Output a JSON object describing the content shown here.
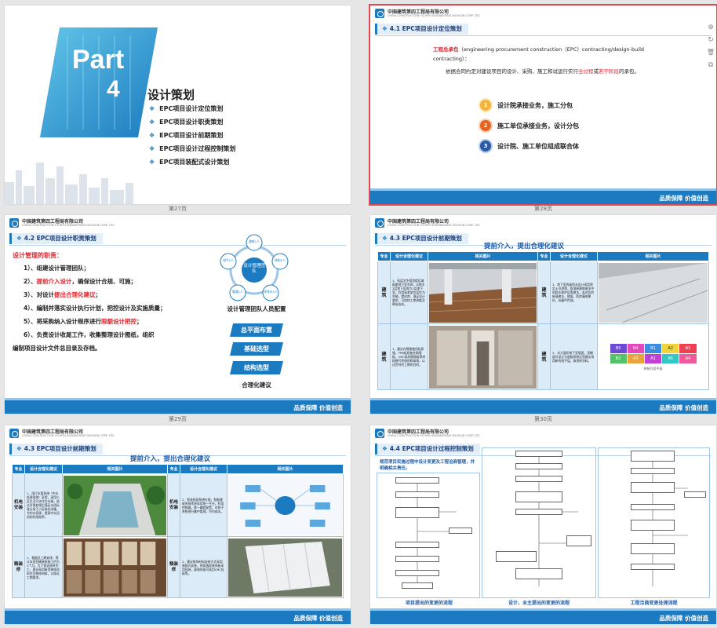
{
  "company": {
    "name": "中国建筑第四工程局有限公司",
    "name_en": "CHINA CONSTRUCTION FOURTH ENGINEERING DIVISION CORP. LTD."
  },
  "footer_text": "品质保障  价值创造",
  "slide27": {
    "part": "Part",
    "part_no": "4",
    "title": "设计策划",
    "items": [
      "EPC项目设计定位策划",
      "EPC项目设计职责策划",
      "EPC项目设计前期策划",
      "EPC项目设计过程控制策划",
      "EPC项目装配式设计策划"
    ],
    "page": "第27页"
  },
  "slide28": {
    "section": "4.1 EPC项目设计定位策划",
    "def_label": "工程总承包",
    "def_text": "（engineering procurement construction（EPC）contracting/design-build contracting）：",
    "body_1": "依据合同约定对建设项目的设计、采购、施工和试运行实行",
    "body_red1": "全过程",
    "body_2": "或",
    "body_red2": "若干阶段",
    "body_3": "的承包。",
    "options": [
      {
        "num": "1",
        "text": "设计院承接业务，施工分包"
      },
      {
        "num": "2",
        "text": "施工单位承接业务，设计分包"
      },
      {
        "num": "3",
        "text": "设计院、施工单位组成联合体"
      }
    ],
    "page": "第28页"
  },
  "slide29": {
    "section": "4.2 EPC项目设计职责策划",
    "duty_title": "设计管理的职责：",
    "duties": [
      {
        "pre": "1）、组建设计管理团队；",
        "red": "",
        "post": ""
      },
      {
        "pre": "2）、",
        "red": "提前介入设计",
        "post": "，确保设计合规、可施；"
      },
      {
        "pre": "3）、对设计",
        "red": "提出合理化建议",
        "post": "；"
      },
      {
        "pre": "4）、编制并落实设计执行计划，把控设计及实施质量；",
        "red": "",
        "post": ""
      },
      {
        "pre": "5）、将采购纳入设计程序进行",
        "red": "限额设计把控",
        "post": "；"
      },
      {
        "pre": "6）、负责设计收尾工作，收集整理设计图纸，组织",
        "red": "",
        "post": ""
      },
      {
        "pre": "编制项目设计文件总目录及存档。",
        "red": "",
        "post": ""
      }
    ],
    "team_center": "设计管理团队",
    "team_nodes": [
      "建筑1人",
      "结构1人",
      "给排水1人",
      "暖通1人",
      "电气1人"
    ],
    "team_caption": "设计管理团队人员配置",
    "proposals": [
      "总平面布置",
      "基础选型",
      "结构选型"
    ],
    "proposal_caption": "合理化建议",
    "page": "第29页"
  },
  "slide30": {
    "section": "4.3 EPC项目设计前期策划",
    "headline": "提前介入，提出合理化建议",
    "headers": [
      "专业",
      "设计合理化建议",
      "相关图片",
      "专业",
      "设计合理化建议",
      "相关图片"
    ],
    "rows": [
      {
        "discipline": "建筑",
        "left": "1、低层学生宿舍楼区域配套地下室车库，D地块2层地下室改为1层地下室，利用高差架空层作为车辆，提成库，满足设计要求，可加快工期进度及降低成本。",
        "right_discipline": "建筑",
        "right": "2、地下室底板防水设计采用密实土坑渗透，取消原建筑做法中的防水保护层等做法，若对比的新墙做法，随离，防渗漏效果好，抗破坏性强。"
      },
      {
        "discipline": "建筑",
        "left": "1、建议内隔墙使用轻质墙，FPB轻质复合隔墙板，GRC轻质隔墙板等材料替代传统的砌体墙，以达到节约工期的目的。",
        "right_discipline": "建筑",
        "right": "2、对大面积地下室墙面，顶棚部分设计为面板质感达到建议采用新的找平层，取消原涂料。"
      }
    ],
    "chart_labels": [
      "B5",
      "B4",
      "B1",
      "A2",
      "B3",
      "B2",
      "A3",
      "A1",
      "A5",
      "A4"
    ],
    "chart_caption": "拼装方案平面",
    "page": "第30页"
  },
  "slide31": {
    "section": "4.3 EPC项目设计前期策划",
    "headline": "提前介入，提出合理化建议",
    "headers": [
      "专业",
      "设计合理化建议",
      "相关图片",
      "专业",
      "设计合理化建议",
      "相关图片"
    ],
    "rows": [
      {
        "discipline": "机电安装",
        "left": "1、雨污水管系统（中水处理系统）采用，采用小区生活污水作为水源，经过环保处理后满足水质标准后用于小区绿化浇灌，节约水资源，提高中水回用的利用效率。",
        "right_discipline": "机电安装",
        "right": "2、智慧校园系统在规，智能建筑系统考虑采用统一平台，利用控制器，统一编程配置，对各子系统进行集中管理，节约成本。"
      },
      {
        "discipline": "精装修",
        "left": "1、根据总工期安排，预计本项目精装修施工约为2个月，为了保证按时完工，建议采用新型装饰材料作为装修材料，以保证工期要求。",
        "right_discipline": "精装修",
        "right": "2、建议装饰材料安装方式采用装配式安装，例如墙面装饰板采用挂装，幕墙饰面可选用GRC挂板等。"
      }
    ],
    "page": ""
  },
  "slide32": {
    "section": "4.4 EPC项目设计过程控制策划",
    "intro": "规范项目实施过程中设计变更及工程洽商管理，并明确相关责任。",
    "flows": [
      "项目提出的变更的流程",
      "设计、业主提出的变更的流程",
      "工程洽商变更处理流程"
    ],
    "page": ""
  }
}
